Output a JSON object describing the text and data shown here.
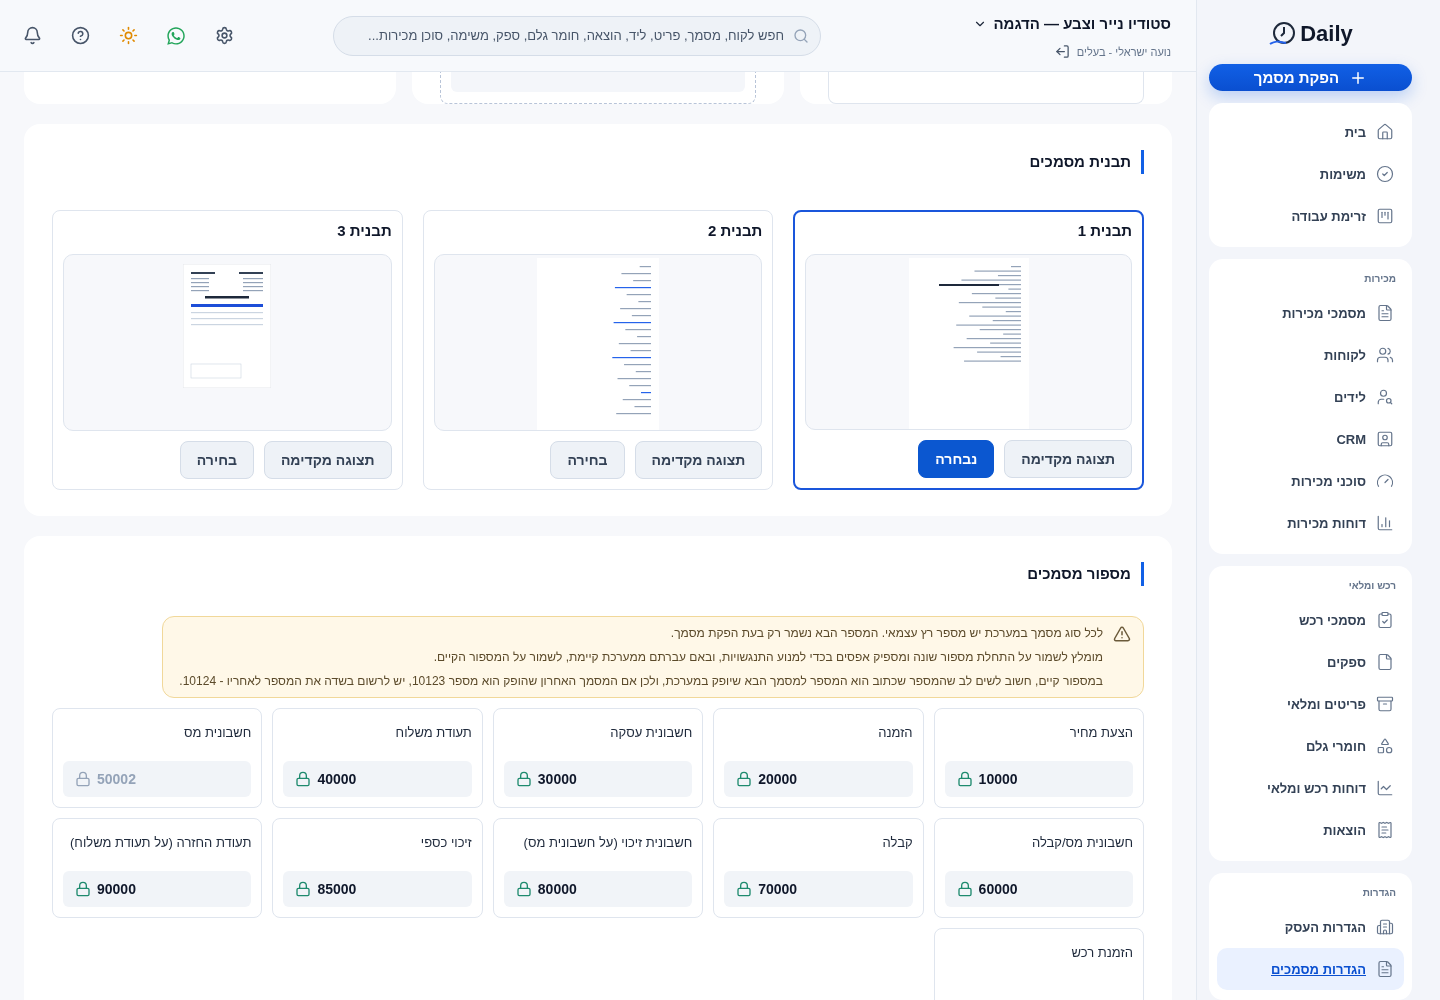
{
  "sidebar": {
    "logo": "Daily",
    "new_document_button": "הפקת מסמך",
    "groups": [
      {
        "items": [
          {
            "label": "בית",
            "selected": false
          },
          {
            "label": "משימות",
            "selected": false
          },
          {
            "label": "זרימת עבודה",
            "selected": false
          }
        ]
      },
      {
        "heading": "מכירות",
        "items": [
          {
            "label": "מסמכי מכירות",
            "selected": false
          },
          {
            "label": "לקוחות",
            "selected": false
          },
          {
            "label": "לידים",
            "selected": false
          },
          {
            "label": "CRM",
            "selected": false
          },
          {
            "label": "סוכני מכירות",
            "selected": false
          },
          {
            "label": "דוחות מכירות",
            "selected": false
          }
        ]
      },
      {
        "heading": "רכש ומלאי",
        "items": [
          {
            "label": "מסמכי רכש",
            "selected": false
          },
          {
            "label": "ספקים",
            "selected": false
          },
          {
            "label": "פריטים ומלאי",
            "selected": false
          },
          {
            "label": "חומרי גלם",
            "selected": false
          },
          {
            "label": "דוחות רכש ומלאי",
            "selected": false
          },
          {
            "label": "הוצאות",
            "selected": false
          }
        ]
      },
      {
        "heading": "הגדרות",
        "items": [
          {
            "label": "הגדרות העסק",
            "selected": false
          },
          {
            "label": "הגדרות מסמכים",
            "selected": true
          }
        ]
      }
    ]
  },
  "header": {
    "business": "סטודיו נייר וצבע — הדגמה",
    "user": "נועה ישראלי - בעלים",
    "search": {
      "placeholder": "חפש לקוח, מסמך, פריט, ליד, הוצאה, חומר גלם, ספק, משימה, סוכן מכירות..."
    }
  },
  "templates_section": {
    "title": "תבנית מסמכים",
    "templates": [
      {
        "name": "תבנית 1",
        "preview_button": "תצוגה מקדימה",
        "select_button": "נבחרה",
        "selected": true
      },
      {
        "name": "תבנית 2",
        "preview_button": "תצוגה מקדימה",
        "select_button": "בחירה",
        "selected": false
      },
      {
        "name": "תבנית 3",
        "preview_button": "תצוגה מקדימה",
        "select_button": "בחירה",
        "selected": false
      }
    ]
  },
  "numbering_section": {
    "title": "מספור מסמכים",
    "notice": [
      "לכל סוג מסמך במערכת יש מספר רץ עצמאי. המספר הבא נשמר רק בעת הפקת מסמך.",
      "מומלץ לשמור על התחלת מספור שונה ומספיק אפסים בכדי למנוע התנגשויות, ובאם עברתם ממערכת קיימת, לשמור על המספור הקיים.",
      "במספור קיים, חשוב לשים לב שהמספר שכתוב הוא המספר למסמך הבא שיופק במערכת, ולכן אם המסמך האחרון שהופק הוא מספר 10123, יש לרשום בשדה את המספר לאחריו - 10124."
    ],
    "counters": [
      {
        "label": "הצעת מחיר",
        "value": "10000",
        "locked": true
      },
      {
        "label": "הזמנה",
        "value": "20000",
        "locked": true
      },
      {
        "label": "חשבונית עסקה",
        "value": "30000",
        "locked": true
      },
      {
        "label": "תעודת משלוח",
        "value": "40000",
        "locked": true
      },
      {
        "label": "חשבונית מס",
        "value": "50002",
        "locked": false
      },
      {
        "label": "חשבונית מס/קבלה",
        "value": "60000",
        "locked": true
      },
      {
        "label": "קבלה",
        "value": "70000",
        "locked": true
      },
      {
        "label": "חשבונית זיכוי (על חשבונית מס)",
        "value": "80000",
        "locked": true
      },
      {
        "label": "זיכוי כספי",
        "value": "85000",
        "locked": true
      },
      {
        "label": "תעודת החזרה (על תעודת משלוח)",
        "value": "90000",
        "locked": true
      },
      {
        "label": "הזמנת רכש"
      }
    ]
  }
}
